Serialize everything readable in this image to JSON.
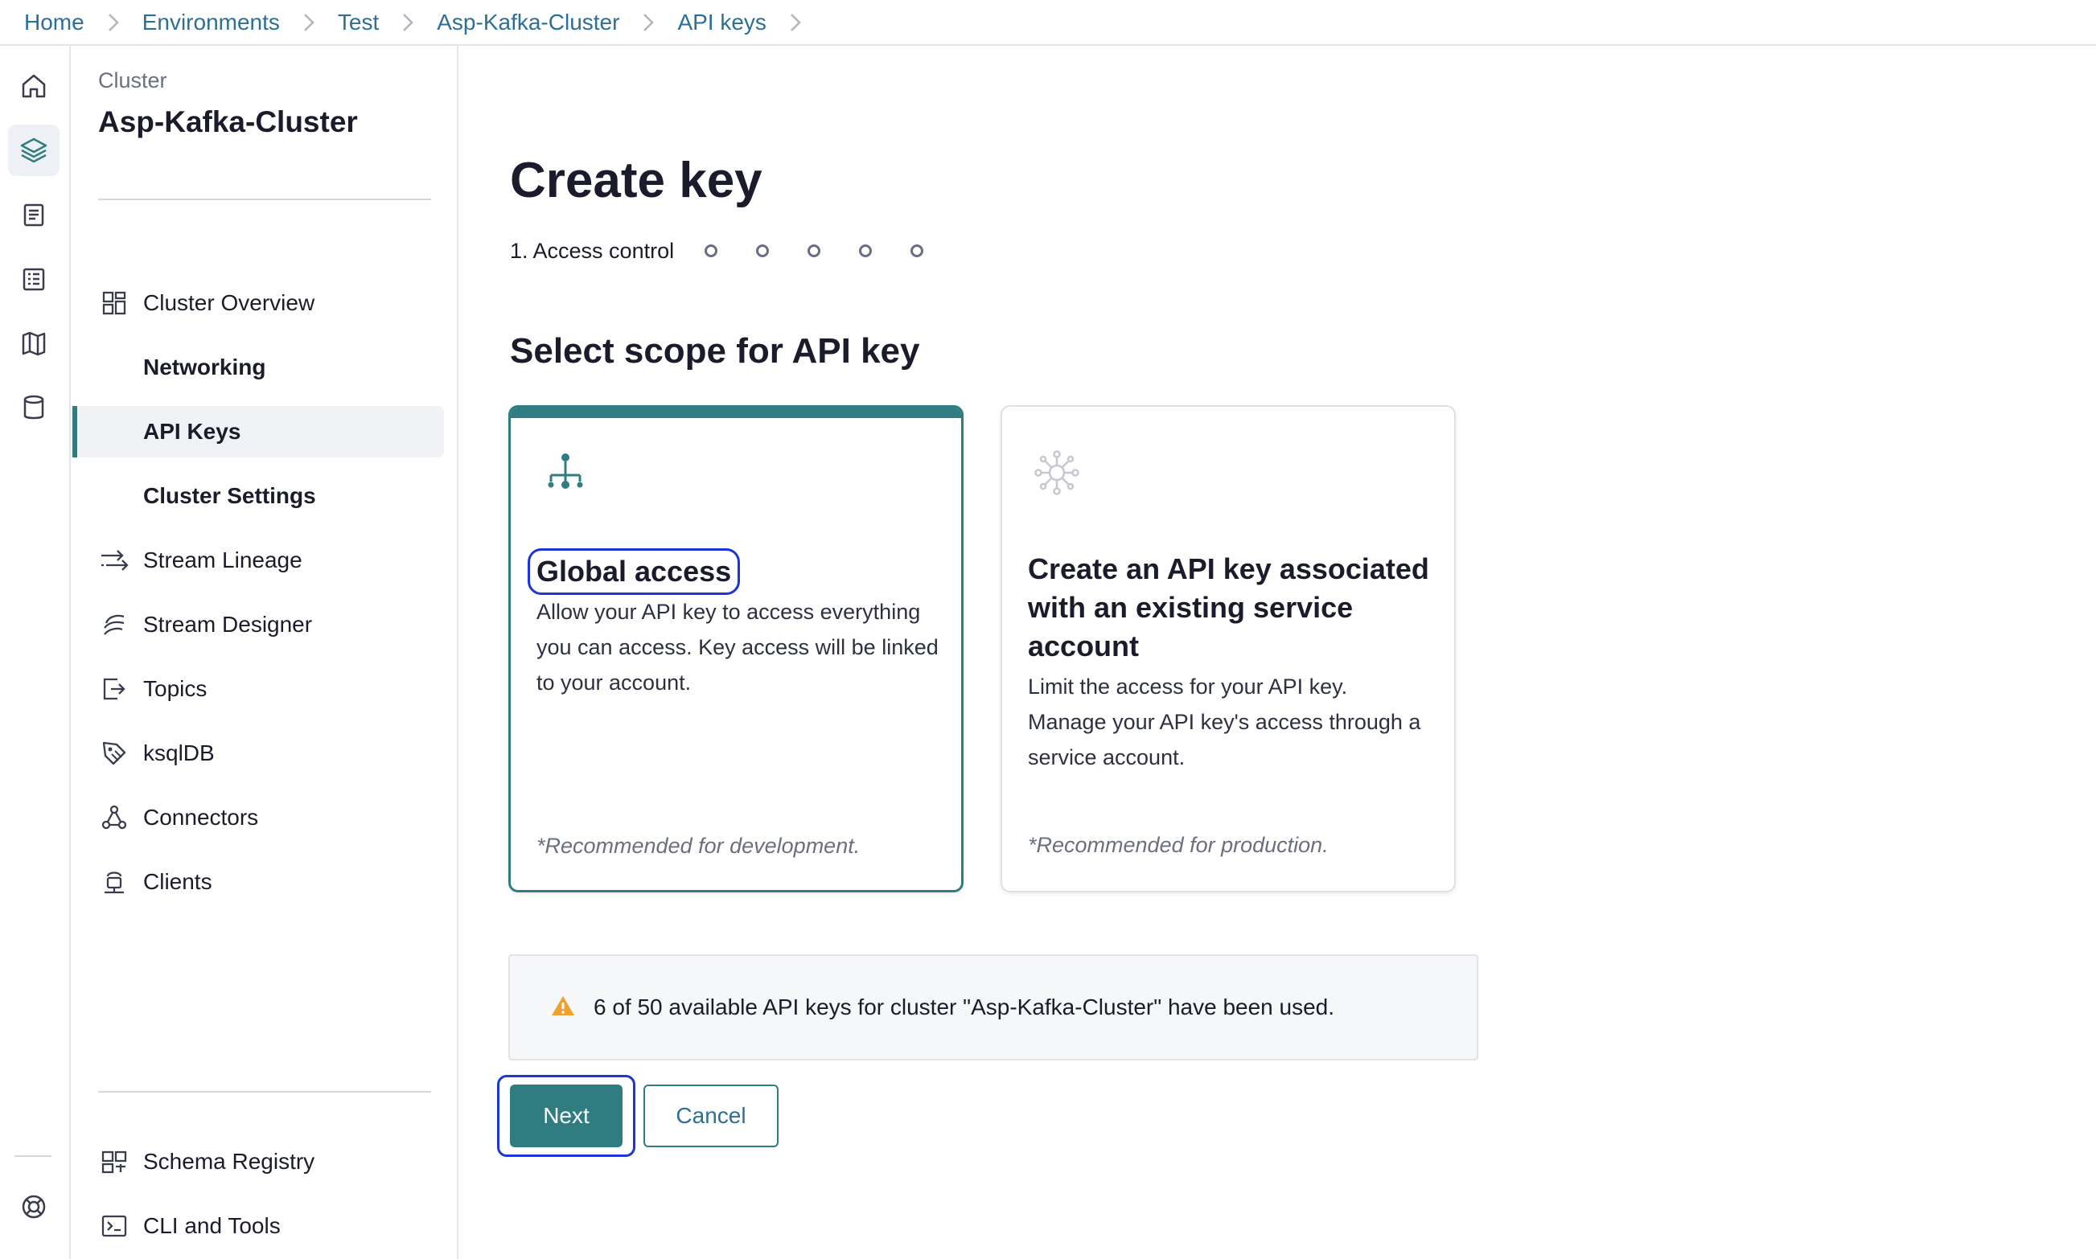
{
  "breadcrumb": [
    "Home",
    "Environments",
    "Test",
    "Asp-Kafka-Cluster",
    "API keys"
  ],
  "sidebar": {
    "eyebrow": "Cluster",
    "title": "Asp-Kafka-Cluster",
    "items": [
      {
        "label": "Cluster Overview",
        "icon": "grid-icon"
      },
      {
        "label": "Networking"
      },
      {
        "label": "API Keys",
        "active": true
      },
      {
        "label": "Cluster Settings"
      },
      {
        "label": "Stream Lineage",
        "icon": "lineage-icon"
      },
      {
        "label": "Stream Designer",
        "icon": "designer-icon"
      },
      {
        "label": "Topics",
        "icon": "topics-icon"
      },
      {
        "label": "ksqlDB",
        "icon": "ksqldb-icon"
      },
      {
        "label": "Connectors",
        "icon": "connectors-icon"
      },
      {
        "label": "Clients",
        "icon": "clients-icon"
      }
    ],
    "bottom_items": [
      {
        "label": "Schema Registry",
        "icon": "schema-registry-icon"
      },
      {
        "label": "CLI and Tools",
        "icon": "terminal-icon"
      }
    ]
  },
  "main": {
    "title": "Create key",
    "stepper": {
      "current_label": "1. Access control",
      "remaining_steps": 5
    },
    "section_title": "Select scope for API key",
    "cards": [
      {
        "title": "Global access",
        "description": "Allow your API key to access everything you can access. Key access will be linked to your account.",
        "note": "*Recommended for development.",
        "selected": true
      },
      {
        "title": "Create an API key associated with an existing service account",
        "description": "Limit the access for your API key. Manage your API key's access through a service account.",
        "note": "*Recommended for production.",
        "selected": false
      }
    ],
    "alert_text": "6 of 50 available API keys for cluster \"Asp-Kafka-Cluster\" have been used.",
    "next_label": "Next",
    "cancel_label": "Cancel"
  },
  "colors": {
    "accent": "#2f7d80",
    "link": "#2c6f97",
    "warning": "#f0a030",
    "focus": "#1d34d6"
  }
}
